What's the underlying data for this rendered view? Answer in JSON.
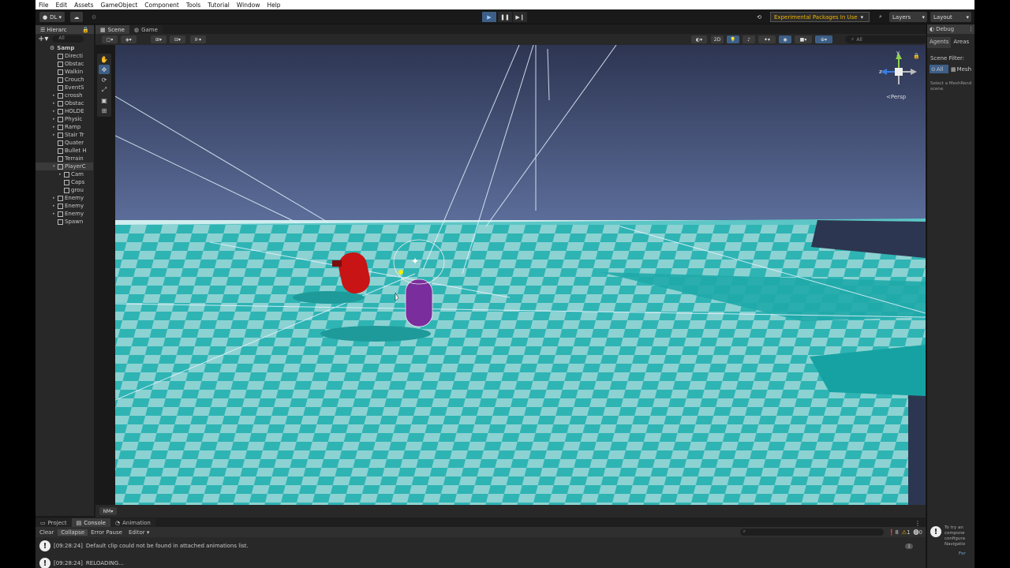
{
  "menu": [
    "File",
    "Edit",
    "Assets",
    "GameObject",
    "Component",
    "Tools",
    "Tutorial",
    "Window",
    "Help"
  ],
  "toolbar": {
    "account": "DL",
    "experimental": "Experimental Packages In Use",
    "layers": "Layers",
    "layout": "Layout"
  },
  "hierarchy": {
    "tab": "Hierarc",
    "search": "All",
    "scene": "Samp",
    "items": [
      "Directi",
      "Obstac",
      "Walkin",
      "Crouch",
      "EventS",
      "crossh",
      "Obstac",
      "HOLDE",
      "Physic",
      "Ramp",
      "Stair Tr",
      "Quater",
      "Bullet H",
      "Terrain",
      "PlayerC",
      "Cam",
      "Caps",
      "grou",
      "Enemy",
      "Enemy",
      "Enemy",
      "Spawn"
    ]
  },
  "scene_tabs": [
    "Scene",
    "Game"
  ],
  "scene_toolbar": {
    "mode_2d": "2D",
    "search": "All",
    "persp": "Persp",
    "nm": "NM"
  },
  "debug_panel": {
    "tab": "Debug",
    "tabs": [
      "Agents",
      "Areas"
    ],
    "scene_filter": "Scene Filter:",
    "filter_all": "All",
    "filter_mesh": "Mesh",
    "hint": "Select a MeshRend scene.",
    "bottom_text": "To try an compone configura Navigatio",
    "bottom_link": "For"
  },
  "bottom_tabs": [
    "Project",
    "Console",
    "Animation"
  ],
  "console": {
    "buttons": [
      "Clear",
      "Collapse",
      "Error Pause",
      "Editor"
    ],
    "counts": {
      "info": "8",
      "warn": "1",
      "error": "0"
    },
    "messages": [
      {
        "time": "[09:28:24]",
        "text": "Default clip could not be found in attached animations list.",
        "count": "1"
      },
      {
        "time": "[09:28:24]",
        "text": "RELOADING...",
        "count": ""
      }
    ]
  },
  "colors": {
    "sky_top": "#2d3552",
    "sky_bottom": "#5d6f9c",
    "floor_light": "#8fd3d3",
    "floor_dark": "#2db3b3",
    "enemy": "#c81414",
    "player": "#7a2d9c",
    "accent_selected": "#3d5f87",
    "warning": "#f0b400"
  }
}
